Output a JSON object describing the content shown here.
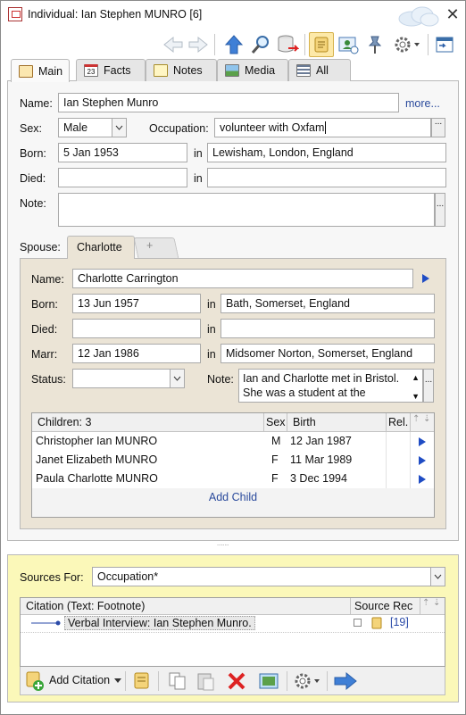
{
  "window": {
    "title": "Individual: Ian Stephen MUNRO [6]",
    "close_label": "✕"
  },
  "tabs": [
    {
      "label": "Main",
      "icon": "main-icon"
    },
    {
      "label": "Facts",
      "icon": "calendar-icon",
      "icon_text": "23"
    },
    {
      "label": "Notes",
      "icon": "notes-icon"
    },
    {
      "label": "Media",
      "icon": "media-icon"
    },
    {
      "label": "All",
      "icon": "all-icon"
    }
  ],
  "main": {
    "name_label": "Name:",
    "name_value": "Ian Stephen Munro",
    "more_link": "more...",
    "sex_label": "Sex:",
    "sex_value": "Male",
    "occupation_label": "Occupation:",
    "occupation_value": "volunteer with Oxfam",
    "born_label": "Born:",
    "born_date": "5 Jan 1953",
    "born_in_label": "in",
    "born_place": "Lewisham, London, England",
    "died_label": "Died:",
    "died_date": "",
    "died_in_label": "in",
    "died_place": "",
    "note_label": "Note:",
    "note_value": ""
  },
  "spouse": {
    "label": "Spouse:",
    "tab_label": "Charlotte",
    "add_tab_label": "+",
    "name_label": "Name:",
    "name_value": "Charlotte Carrington",
    "born_label": "Born:",
    "born_date": "13 Jun 1957",
    "born_in_label": "in",
    "born_place": "Bath, Somerset, England",
    "died_label": "Died:",
    "died_date": "",
    "died_in_label": "in",
    "died_place": "",
    "marr_label": "Marr:",
    "marr_date": "12 Jan 1986",
    "marr_in_label": "in",
    "marr_place": "Midsomer Norton, Somerset, England",
    "status_label": "Status:",
    "status_value": "",
    "note_label": "Note:",
    "note_line1": "Ian and Charlotte met in Bristol.",
    "note_line2": "She was a student at the"
  },
  "children": {
    "header_children": "Children: 3",
    "header_sex": "Sex",
    "header_birth": "Birth",
    "header_rel": "Rel.",
    "rows": [
      {
        "name": "Christopher Ian MUNRO",
        "sex": "M",
        "birth": "12 Jan 1987"
      },
      {
        "name": "Janet Elizabeth MUNRO",
        "sex": "F",
        "birth": "11 Mar 1989"
      },
      {
        "name": "Paula Charlotte MUNRO",
        "sex": "F",
        "birth": "3 Dec 1994"
      }
    ],
    "add_child_label": "Add Child"
  },
  "sources": {
    "label": "Sources For:",
    "selected": "Occupation*",
    "header_citation": "Citation (Text: Footnote)",
    "header_source_rec": "Source Rec",
    "rows": [
      {
        "citation": "Verbal Interview:  Ian Stephen Munro.",
        "ref": "[19]"
      }
    ],
    "add_citation_label": "Add Citation"
  },
  "splitter_glyph": "˙˙˙˙˙˙˙˙",
  "colors": {
    "spouse_panel": "#ebe4d6",
    "sources_panel": "#fbf8b9",
    "link": "#2a4a9c",
    "play_arrow": "#1f4cc4"
  }
}
